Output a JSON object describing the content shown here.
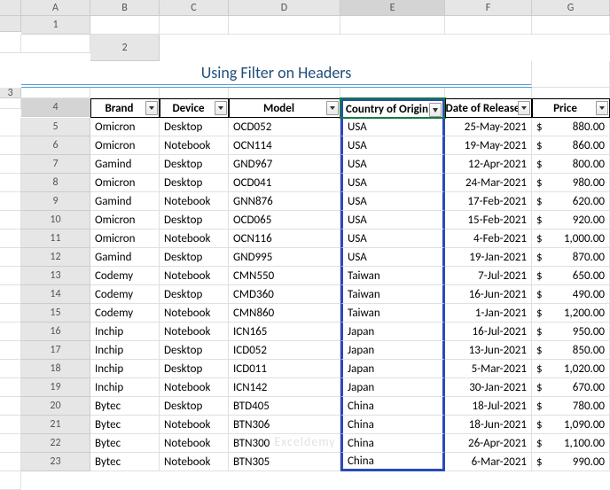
{
  "columns": [
    "A",
    "B",
    "C",
    "D",
    "E",
    "F",
    "G"
  ],
  "title": "Using Filter on Headers",
  "headers": {
    "brand": "Brand",
    "device": "Device",
    "model": "Model",
    "country": "Country of Origin",
    "date": "Date of Release",
    "price": "Price"
  },
  "active_header_col": "E",
  "rows": [
    {
      "n": 5,
      "brand": "Omicron",
      "device": "Desktop",
      "model": "OCD052",
      "country": "USA",
      "date": "25-May-2021",
      "price": "880.00"
    },
    {
      "n": 6,
      "brand": "Omicron",
      "device": "Notebook",
      "model": "OCN114",
      "country": "USA",
      "date": "19-May-2021",
      "price": "860.00"
    },
    {
      "n": 7,
      "brand": "Gamind",
      "device": "Desktop",
      "model": "GND967",
      "country": "USA",
      "date": "12-Apr-2021",
      "price": "800.00"
    },
    {
      "n": 8,
      "brand": "Omicron",
      "device": "Desktop",
      "model": "OCD041",
      "country": "USA",
      "date": "24-Mar-2021",
      "price": "980.00"
    },
    {
      "n": 9,
      "brand": "Gamind",
      "device": "Notebook",
      "model": "GNN876",
      "country": "USA",
      "date": "17-Feb-2021",
      "price": "620.00"
    },
    {
      "n": 10,
      "brand": "Omicron",
      "device": "Desktop",
      "model": "OCD065",
      "country": "USA",
      "date": "15-Feb-2021",
      "price": "920.00"
    },
    {
      "n": 11,
      "brand": "Omicron",
      "device": "Notebook",
      "model": "OCN116",
      "country": "USA",
      "date": "4-Feb-2021",
      "price": "1,000.00"
    },
    {
      "n": 12,
      "brand": "Gamind",
      "device": "Desktop",
      "model": "GND995",
      "country": "USA",
      "date": "19-Jan-2021",
      "price": "870.00"
    },
    {
      "n": 13,
      "brand": "Codemy",
      "device": "Notebook",
      "model": "CMN550",
      "country": "Taiwan",
      "date": "7-Jul-2021",
      "price": "650.00"
    },
    {
      "n": 14,
      "brand": "Codemy",
      "device": "Desktop",
      "model": "CMD360",
      "country": "Taiwan",
      "date": "16-Jun-2021",
      "price": "490.00"
    },
    {
      "n": 15,
      "brand": "Codemy",
      "device": "Notebook",
      "model": "CMN860",
      "country": "Taiwan",
      "date": "1-Jan-2021",
      "price": "1,200.00"
    },
    {
      "n": 16,
      "brand": "Inchip",
      "device": "Notebook",
      "model": "ICN165",
      "country": "Japan",
      "date": "16-Jul-2021",
      "price": "950.00"
    },
    {
      "n": 17,
      "brand": "Inchip",
      "device": "Desktop",
      "model": "ICD052",
      "country": "Japan",
      "date": "13-Jun-2021",
      "price": "850.00"
    },
    {
      "n": 18,
      "brand": "Inchip",
      "device": "Desktop",
      "model": "ICD011",
      "country": "Japan",
      "date": "5-Mar-2021",
      "price": "1,020.00"
    },
    {
      "n": 19,
      "brand": "Inchip",
      "device": "Notebook",
      "model": "ICN142",
      "country": "Japan",
      "date": "30-Jan-2021",
      "price": "670.00"
    },
    {
      "n": 20,
      "brand": "Bytec",
      "device": "Desktop",
      "model": "BTD405",
      "country": "China",
      "date": "18-Jul-2021",
      "price": "780.00"
    },
    {
      "n": 21,
      "brand": "Bytec",
      "device": "Notebook",
      "model": "BTN306",
      "country": "China",
      "date": "18-Jun-2021",
      "price": "1,090.00"
    },
    {
      "n": 22,
      "brand": "Bytec",
      "device": "Notebook",
      "model": "BTN300",
      "country": "China",
      "date": "26-Apr-2021",
      "price": "1,100.00"
    },
    {
      "n": 23,
      "brand": "Bytec",
      "device": "Notebook",
      "model": "BTN305",
      "country": "China",
      "date": "6-Mar-2021",
      "price": "990.00"
    }
  ],
  "currency": "$",
  "watermark": "Exceldemy"
}
